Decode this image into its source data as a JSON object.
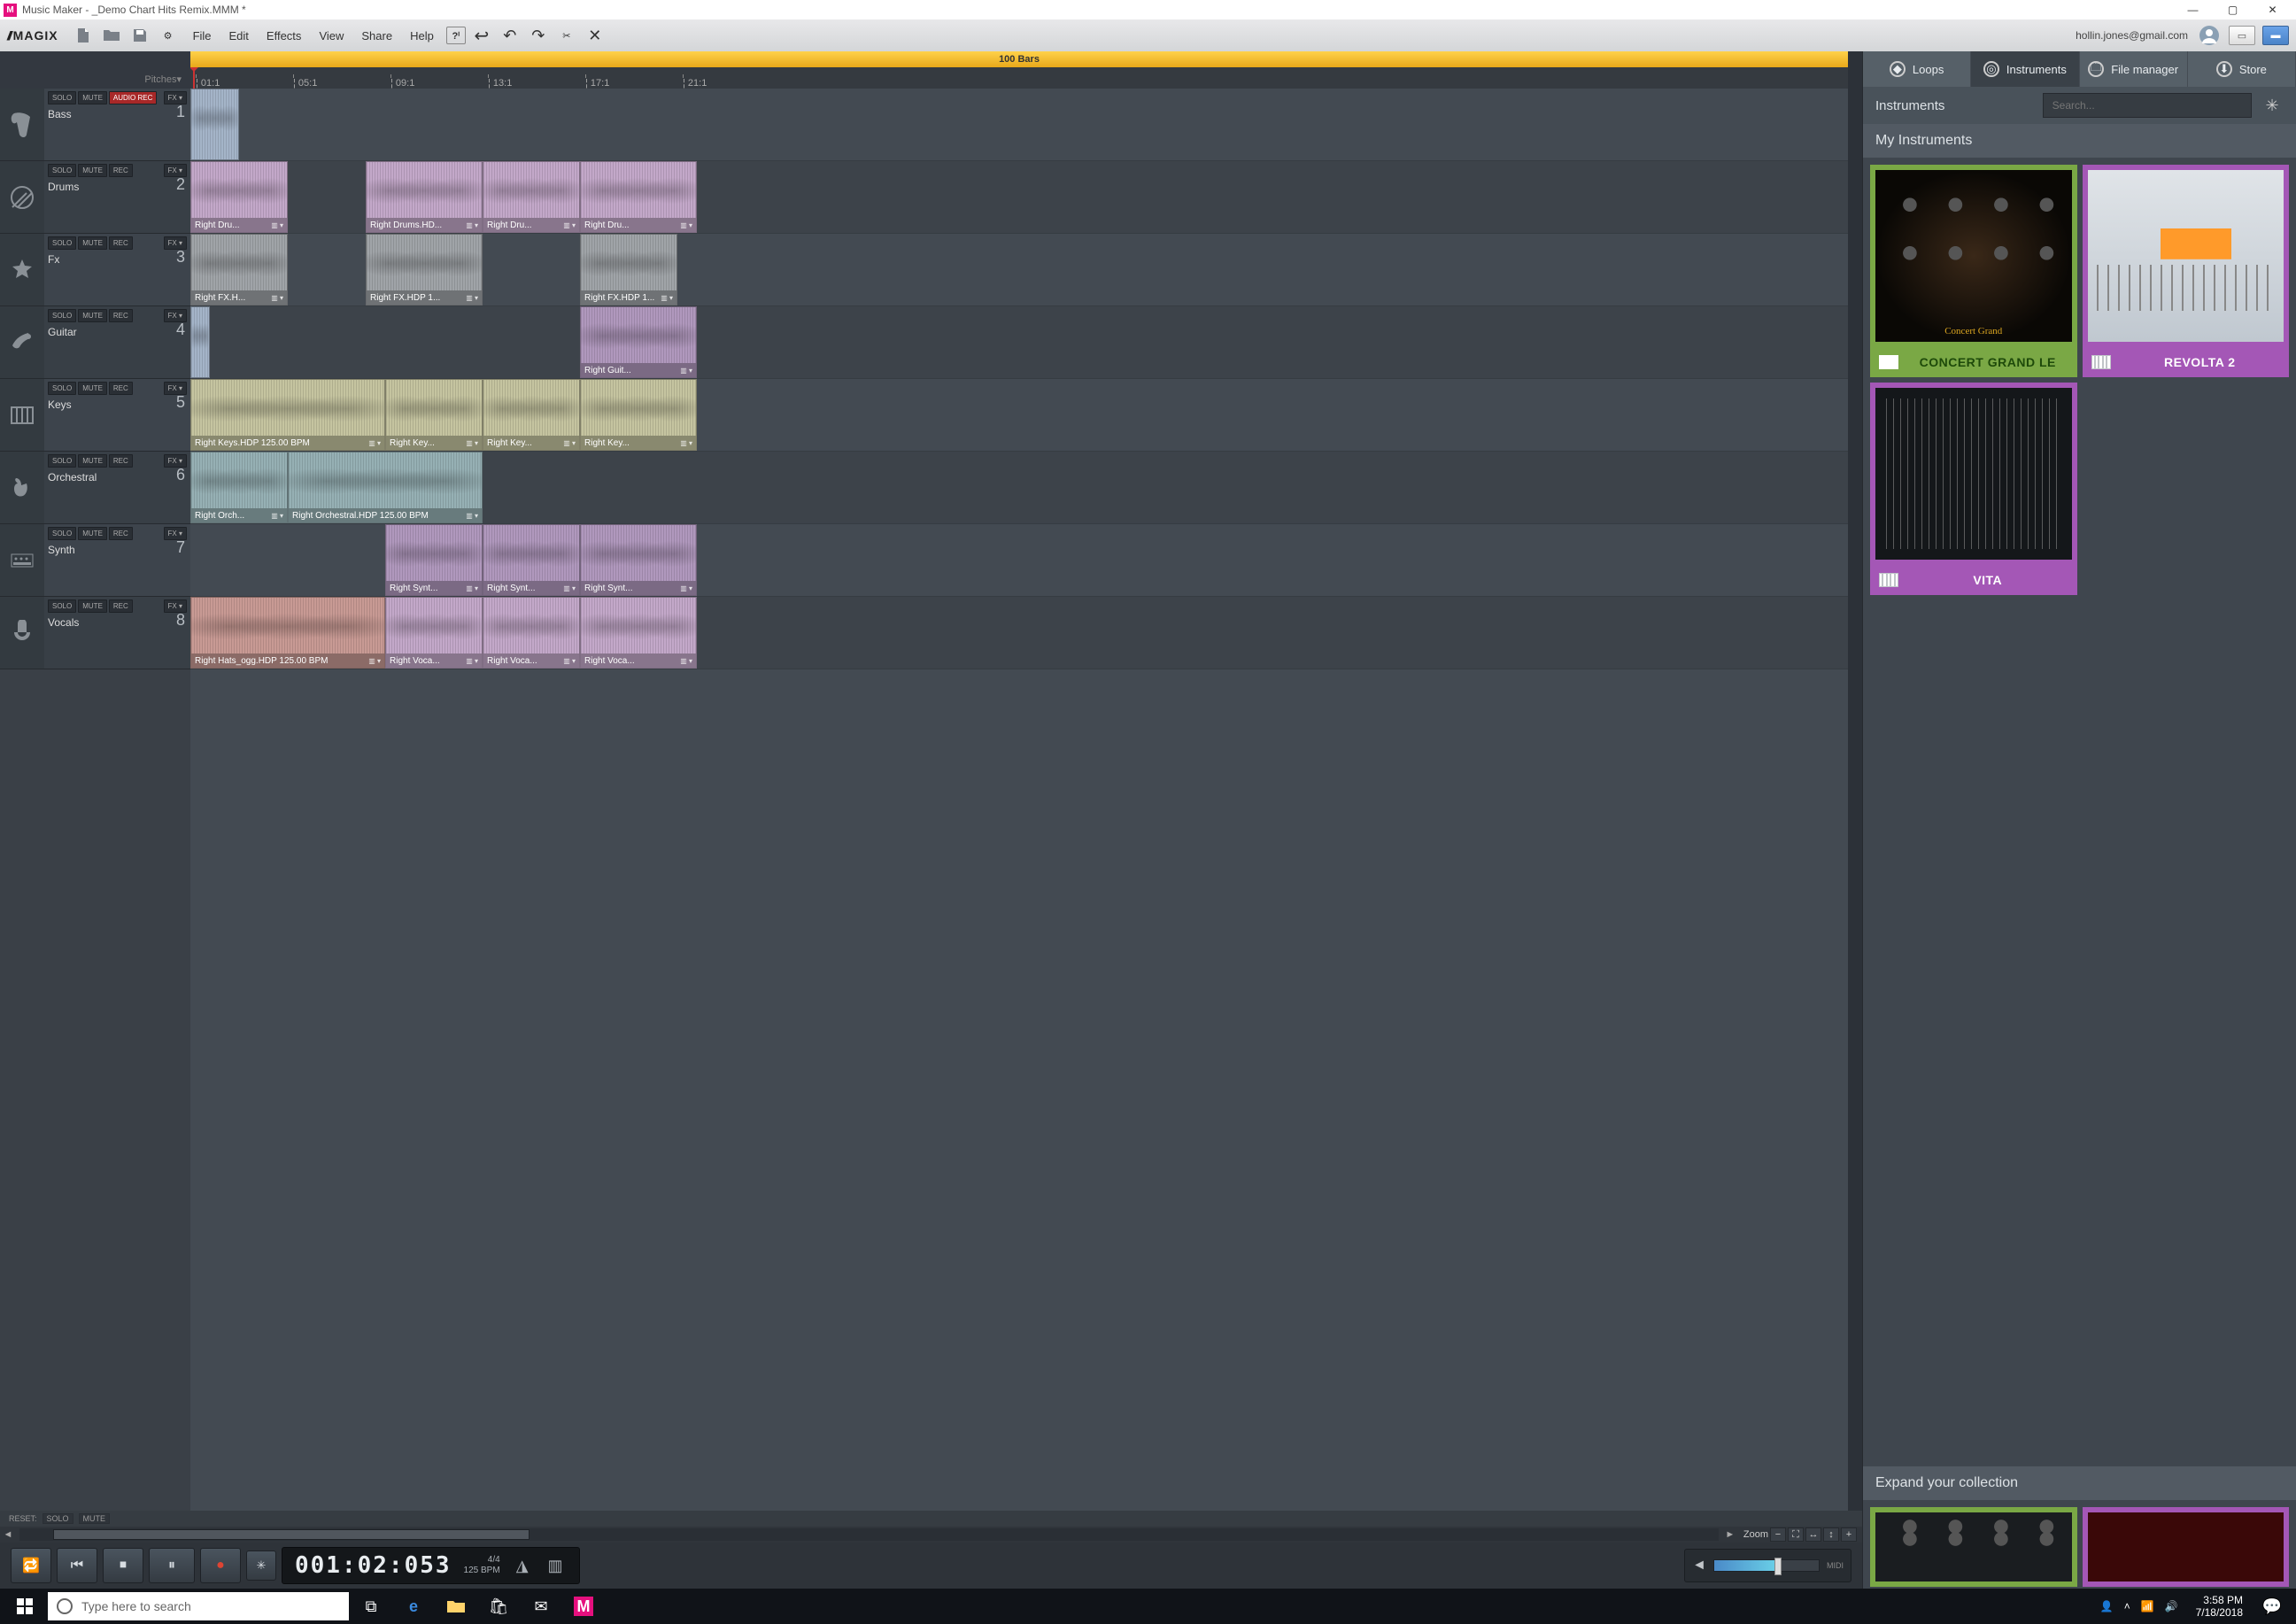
{
  "window": {
    "title": "Music Maker - _Demo Chart Hits Remix.MMM *"
  },
  "brand": "MAGIX",
  "menus": [
    "File",
    "Edit",
    "Effects",
    "View",
    "Share",
    "Help"
  ],
  "account": "hollin.jones@gmail.com",
  "timeline": {
    "pitches_label": "Pitches",
    "bars_label": "100 Bars",
    "ticks": [
      "01:1",
      "05:1",
      "09:1",
      "13:1",
      "17:1",
      "21:1"
    ]
  },
  "track_buttons": {
    "solo": "SOLO",
    "mute": "MUTE",
    "rec": "REC",
    "audio_rec": "AUDIO REC",
    "fx": "FX ▾"
  },
  "tracks": [
    {
      "num": 1,
      "name": "Bass",
      "rec_mode": "audio",
      "clips": [
        {
          "start": 0,
          "len": 5,
          "color": "c-blue",
          "label": ""
        }
      ]
    },
    {
      "num": 2,
      "name": "Drums",
      "rec_mode": "rec",
      "clips": [
        {
          "start": 0,
          "len": 10,
          "color": "c-purple",
          "label": "Right Dru..."
        },
        {
          "start": 18,
          "len": 12,
          "color": "c-purple",
          "label": "Right Drums.HD..."
        },
        {
          "start": 30,
          "len": 10,
          "color": "c-purple",
          "label": "Right Dru..."
        },
        {
          "start": 40,
          "len": 12,
          "color": "c-purple",
          "label": "Right Dru..."
        }
      ]
    },
    {
      "num": 3,
      "name": "Fx",
      "rec_mode": "rec",
      "clips": [
        {
          "start": 0,
          "len": 10,
          "color": "c-grey",
          "label": "Right FX.H..."
        },
        {
          "start": 18,
          "len": 12,
          "color": "c-grey",
          "label": "Right FX.HDP 1..."
        },
        {
          "start": 40,
          "len": 10,
          "color": "c-grey",
          "label": "Right FX.HDP 1..."
        }
      ]
    },
    {
      "num": 4,
      "name": "Guitar",
      "rec_mode": "rec",
      "clips": [
        {
          "start": 0,
          "len": 2,
          "color": "c-blue",
          "label": ""
        },
        {
          "start": 40,
          "len": 12,
          "color": "c-purple2",
          "label": "Right Guit..."
        }
      ]
    },
    {
      "num": 5,
      "name": "Keys",
      "rec_mode": "rec",
      "clips": [
        {
          "start": 0,
          "len": 20,
          "color": "c-olive",
          "label": "Right Keys.HDP 125.00 BPM"
        },
        {
          "start": 20,
          "len": 10,
          "color": "c-olive",
          "label": "Right Key..."
        },
        {
          "start": 30,
          "len": 10,
          "color": "c-olive",
          "label": "Right Key..."
        },
        {
          "start": 40,
          "len": 12,
          "color": "c-olive",
          "label": "Right Key..."
        }
      ]
    },
    {
      "num": 6,
      "name": "Orchestral",
      "rec_mode": "rec",
      "clips": [
        {
          "start": 0,
          "len": 10,
          "color": "c-teal",
          "label": "Right Orch..."
        },
        {
          "start": 10,
          "len": 20,
          "color": "c-teal",
          "label": "Right Orchestral.HDP 125.00 BPM"
        }
      ]
    },
    {
      "num": 7,
      "name": "Synth",
      "rec_mode": "rec",
      "clips": [
        {
          "start": 20,
          "len": 10,
          "color": "c-purple2",
          "label": "Right Synt..."
        },
        {
          "start": 30,
          "len": 10,
          "color": "c-purple2",
          "label": "Right Synt..."
        },
        {
          "start": 40,
          "len": 12,
          "color": "c-purple2",
          "label": "Right Synt..."
        }
      ]
    },
    {
      "num": 8,
      "name": "Vocals",
      "rec_mode": "rec",
      "clips": [
        {
          "start": 0,
          "len": 20,
          "color": "c-rose",
          "label": "Right Hats_ogg.HDP 125.00 BPM"
        },
        {
          "start": 20,
          "len": 10,
          "color": "c-purple",
          "label": "Right Voca..."
        },
        {
          "start": 30,
          "len": 10,
          "color": "c-purple",
          "label": "Right Voca..."
        },
        {
          "start": 40,
          "len": 12,
          "color": "c-purple",
          "label": "Right Voca..."
        }
      ]
    }
  ],
  "resetbar": {
    "reset": "RESET:",
    "solo": "SOLO",
    "mute": "MUTE"
  },
  "zoom_label": "Zoom",
  "transport": {
    "timecode": "001:02:053",
    "signature": "4/4",
    "bpm": "125 BPM"
  },
  "midi_label": "MIDI",
  "sidepanel": {
    "tabs": [
      {
        "id": "loops",
        "label": "Loops"
      },
      {
        "id": "instruments",
        "label": "Instruments"
      },
      {
        "id": "filemgr",
        "label": "File manager"
      },
      {
        "id": "store",
        "label": "Store"
      }
    ],
    "heading": "Instruments",
    "search_placeholder": "Search...",
    "section_my": "My Instruments",
    "section_expand": "Expand your collection",
    "instruments": [
      {
        "name": "CONCERT GRAND LE",
        "theme": "green",
        "preview": "piano knobs"
      },
      {
        "name": "REVOLTA 2",
        "theme": "purple",
        "preview": "synth"
      },
      {
        "name": "VITA",
        "theme": "purple",
        "preview": "vita"
      }
    ]
  },
  "taskbar": {
    "search_placeholder": "Type here to search",
    "time": "3:58 PM",
    "date": "7/18/2018"
  }
}
